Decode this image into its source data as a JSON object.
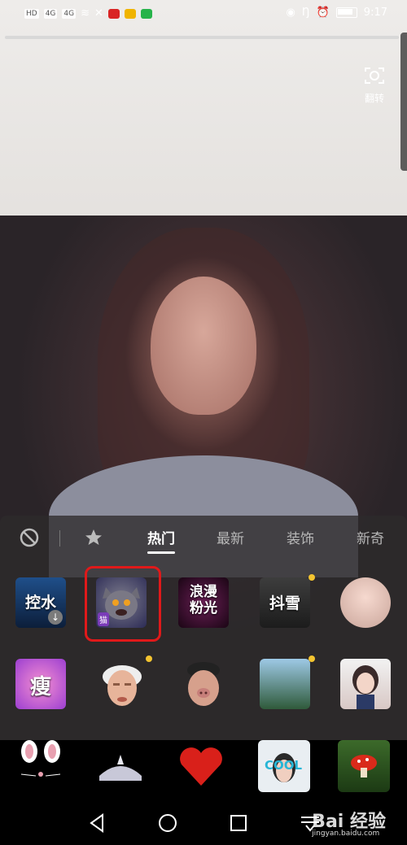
{
  "status_bar": {
    "left_chips": [
      "HD",
      "4G",
      "4G"
    ],
    "time": "9:17",
    "icons": [
      "signal-icon",
      "wifi-icon",
      "missed-call-icon",
      "video-app-icon",
      "mail-app-icon",
      "message-app-icon",
      "eye-icon",
      "nfc-icon",
      "alarm-icon",
      "battery-icon"
    ]
  },
  "camera": {
    "flip_label": "翻转"
  },
  "tabs": [
    {
      "label": "热门",
      "active": true
    },
    {
      "label": "最新"
    },
    {
      "label": "装饰"
    },
    {
      "label": "新奇"
    }
  ],
  "stickers_row1": [
    {
      "label": "控水",
      "has_download": true
    },
    {
      "label": "猫",
      "selected": true
    },
    {
      "label": "浪漫\n粉光"
    },
    {
      "label": "抖雪",
      "has_dot": true
    },
    {
      "label": ""
    }
  ],
  "stickers_row2": [
    {
      "label": "瘦"
    },
    {
      "label": "",
      "has_dot": true
    },
    {
      "label": ""
    },
    {
      "label": "",
      "has_dot": true
    },
    {
      "label": ""
    }
  ],
  "bottom_stickers": [
    "bunny-ears-sticker",
    "tiara-sticker",
    "heart-sticker",
    "cool-glasses-sticker",
    "mushroom-sticker"
  ],
  "bottom_labels": {
    "cool": "COOL"
  },
  "watermark": {
    "text": "Bai 经验",
    "sub": "jingyan.baidu.com"
  }
}
